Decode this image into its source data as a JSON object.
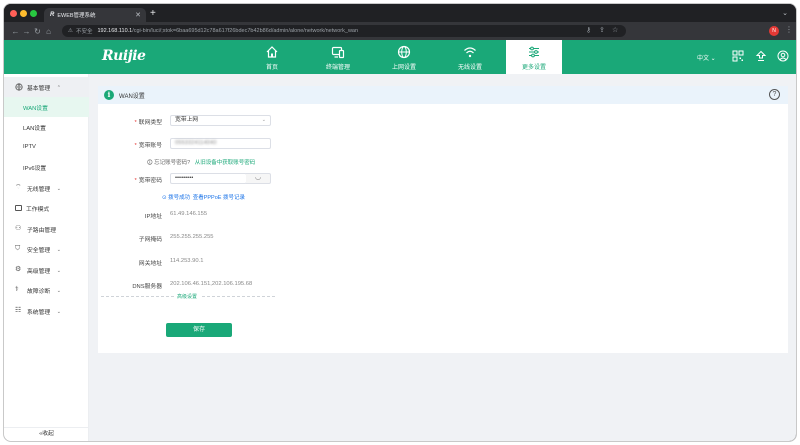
{
  "browser": {
    "tab_title": "EWEB管理系统",
    "tab_close": "✕",
    "new_tab": "+",
    "address": {
      "insecure_label": "不安全",
      "host": "192.168.110.1",
      "path": "/cgi-bin/luci/;stok=6baa695d12c78a617f26bdec7b42b86d/admin/alone/network/network_wan"
    }
  },
  "header": {
    "logo": "Ruijie",
    "nav": [
      {
        "label": "首页",
        "icon": "home-icon"
      },
      {
        "label": "终端管理",
        "icon": "devices-icon"
      },
      {
        "label": "上网设置",
        "icon": "globe-icon"
      },
      {
        "label": "无线设置",
        "icon": "wifi-icon"
      },
      {
        "label": "更多设置",
        "icon": "sliders-icon",
        "active": true
      }
    ],
    "language": "中文"
  },
  "sidebar": {
    "groups": [
      {
        "label": "基本管理",
        "icon": "globe-icon",
        "expanded": true
      },
      {
        "label": "无线管理",
        "icon": "wifi-icon"
      },
      {
        "label": "工作模式",
        "icon": "mode-icon"
      },
      {
        "label": "子路由管理",
        "icon": "sub-router-icon"
      },
      {
        "label": "安全管理",
        "icon": "shield-icon"
      },
      {
        "label": "高级管理",
        "icon": "advanced-icon"
      },
      {
        "label": "故障诊断",
        "icon": "diagnose-icon"
      },
      {
        "label": "系统管理",
        "icon": "system-icon"
      }
    ],
    "sub_items": [
      {
        "label": "WAN设置",
        "active": true
      },
      {
        "label": "LAN设置"
      },
      {
        "label": "IPTV"
      },
      {
        "label": "IPv6设置"
      }
    ],
    "collapse_label": "«收起"
  },
  "panel": {
    "title": "WAN设置",
    "form": {
      "conn_type_label": "联网类型",
      "conn_type_value": "宽带上网",
      "account_label": "宽带账号",
      "account_value": "0553324114040",
      "forgot_hint": "忘记账号密码?",
      "forgot_link": "从旧设备中获取账号密码",
      "password_label": "宽带密码",
      "password_value": "•••••••••",
      "dial_status": "拨号成功",
      "dial_link": "查看PPPoE 拨号记录",
      "ip_label": "IP地址",
      "ip_value": "61.49.146.155",
      "mask_label": "子网掩码",
      "mask_value": "255.255.255.255",
      "gateway_label": "网关地址",
      "gateway_value": "114.253.90.1",
      "dns_label": "DNS服务器",
      "dns_value": "202.106.46.151,202.106.195.68",
      "advanced_label": "高级设置",
      "save_label": "保存"
    }
  },
  "colors": {
    "brand": "#1aa878",
    "panel_header": "#eaf3fb",
    "required": "#e53935"
  }
}
